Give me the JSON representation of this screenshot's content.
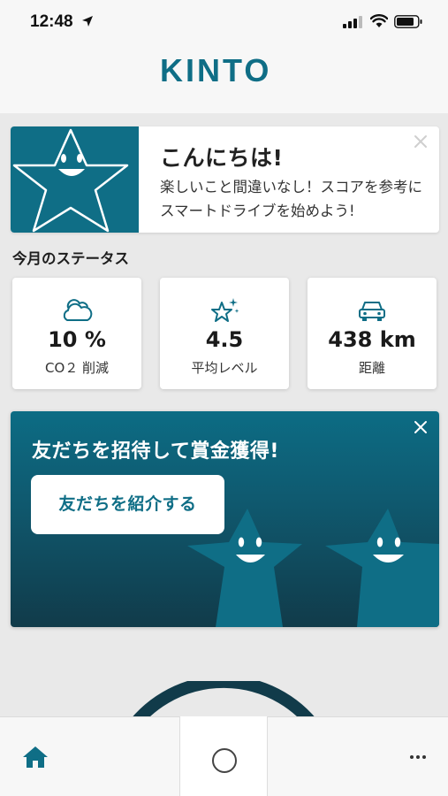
{
  "status_bar": {
    "time": "12:48"
  },
  "header": {
    "logo_text": "KINTO"
  },
  "greeting": {
    "title": "こんにちは!",
    "body": "楽しいこと間違いなし！スコアを参考にスマートドライブを始めよう!"
  },
  "status_section": {
    "title": "今月のステータス",
    "cards": [
      {
        "icon": "cloud-icon",
        "value": "10 %",
        "label": "CO２ 削減"
      },
      {
        "icon": "sparkle-star-icon",
        "value": "4.5",
        "label": "平均レベル"
      },
      {
        "icon": "car-icon",
        "value": "438 km",
        "label": "距離"
      }
    ]
  },
  "invite": {
    "title": "友だちを招待して賞金獲得!",
    "button_label": "友だちを紹介する"
  },
  "bottom_nav": {
    "home_icon": "home-icon",
    "center_icon": "circle-icon",
    "more_icon": "more-icon"
  },
  "colors": {
    "brand": "#0f6e86",
    "banner_dark": "#113b4a",
    "background": "#e9e9e9"
  }
}
